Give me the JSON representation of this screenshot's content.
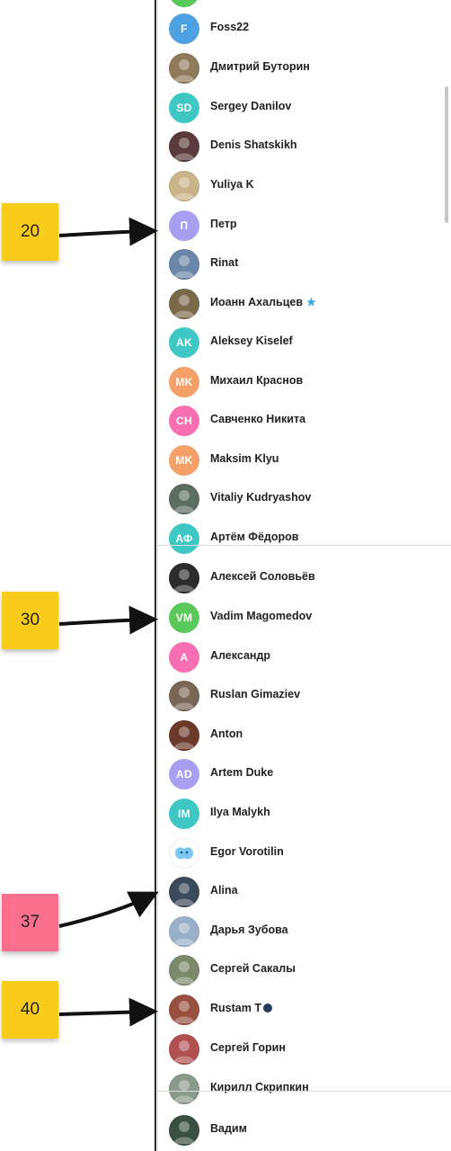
{
  "annotations": [
    {
      "label": "20",
      "color": "#f7cc1b"
    },
    {
      "label": "30",
      "color": "#f7cc1b"
    },
    {
      "label": "37",
      "color": "#fb6f8f"
    },
    {
      "label": "40",
      "color": "#f7cc1b"
    }
  ],
  "contacts": [
    {
      "name": "Foss22",
      "initials": "F",
      "color": "#4ea1e0"
    },
    {
      "name": "Дмитрий Буторин",
      "initials": "",
      "color": "#8f7a5a",
      "icon": "photo-avatar"
    },
    {
      "name": "Sergey Danilov",
      "initials": "SD",
      "color": "#3fc7c4"
    },
    {
      "name": "Denis Shatskikh",
      "initials": "",
      "color": "#5a3a3a",
      "icon": "photo-avatar"
    },
    {
      "name": "Yuliya K",
      "initials": "",
      "color": "#c9b48a",
      "icon": "photo-avatar"
    },
    {
      "name": "Петр",
      "initials": "П",
      "color": "#a99ff0"
    },
    {
      "name": "Rinat",
      "initials": "",
      "color": "#6a86a8",
      "icon": "photo-avatar"
    },
    {
      "name": "Иоанн Ахальцев",
      "initials": "",
      "color": "#7a6a4a",
      "icon": "photo-avatar",
      "badge": "★"
    },
    {
      "name": "Aleksey Kiselef",
      "initials": "AK",
      "color": "#3fc7c4"
    },
    {
      "name": "Михаил Краснов",
      "initials": "MK",
      "color": "#f4a068"
    },
    {
      "name": "Савченко Никита",
      "initials": "CH",
      "color": "#f76fb0"
    },
    {
      "name": "Maksim Klyu",
      "initials": "MK",
      "color": "#f4a068"
    },
    {
      "name": "Vitaliy Kudryashov",
      "initials": "",
      "color": "#5c6e60",
      "icon": "photo-avatar"
    },
    {
      "name": "Артём Фёдоров",
      "initials": "АФ",
      "color": "#3fc7c4"
    },
    {
      "name": "Алексей Соловьёв",
      "initials": "",
      "color": "#2c2c2c",
      "icon": "photo-avatar"
    },
    {
      "name": "Vadim Magomedov",
      "initials": "VM",
      "color": "#5ac85a"
    },
    {
      "name": "Александр",
      "initials": "A",
      "color": "#f76fb0"
    },
    {
      "name": "Ruslan Gimaziev",
      "initials": "",
      "color": "#7a6655",
      "icon": "photo-avatar"
    },
    {
      "name": "Anton",
      "initials": "",
      "color": "#6b3a2a",
      "icon": "photo-avatar"
    },
    {
      "name": "Artem Duke",
      "initials": "AD",
      "color": "#a99ff0"
    },
    {
      "name": "Ilya Malykh",
      "initials": "IM",
      "color": "#3fc7c4"
    },
    {
      "name": "Egor Vorotilin",
      "initials": "",
      "color": "#ffffff",
      "icon": "sticker-avatar"
    },
    {
      "name": "Alina",
      "initials": "",
      "color": "#3a4a5a",
      "icon": "photo-avatar"
    },
    {
      "name": "Дарья Зубова",
      "initials": "",
      "color": "#9ab0c8",
      "icon": "photo-avatar"
    },
    {
      "name": "Сергей Сакалы",
      "initials": "",
      "color": "#7a8a6a",
      "icon": "photo-avatar"
    },
    {
      "name": "Rustam T",
      "initials": "",
      "color": "#9a5040",
      "icon": "photo-avatar",
      "badge_icon": "moon-dot"
    },
    {
      "name": "Сергей Горин",
      "initials": "",
      "color": "#b05050",
      "icon": "photo-avatar"
    },
    {
      "name": "Кирилл Скрипкин",
      "initials": "",
      "color": "#8a9a8a",
      "icon": "photo-avatar"
    },
    {
      "name": "Вадим",
      "initials": "",
      "color": "#3a5040",
      "icon": "photo-avatar"
    }
  ]
}
